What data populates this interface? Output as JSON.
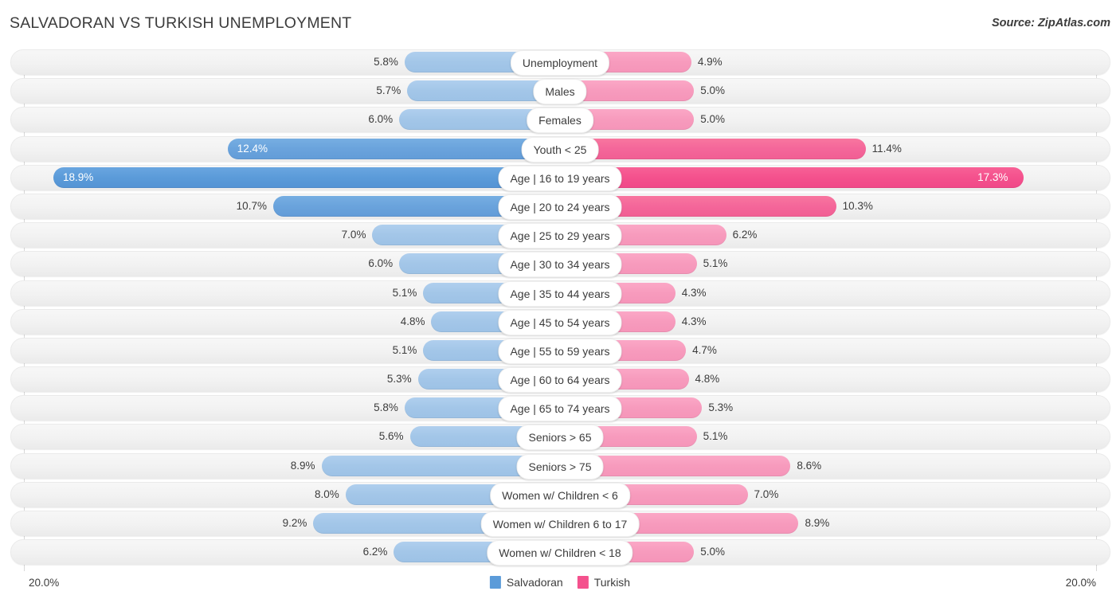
{
  "header": {
    "title": "SALVADORAN VS TURKISH UNEMPLOYMENT",
    "source": "Source: ZipAtlas.com"
  },
  "axis": {
    "min_label": "20.0%",
    "max_label": "20.0%"
  },
  "legend": {
    "items": [
      {
        "label": "Salvadoran",
        "color": "#5b9bd9"
      },
      {
        "label": "Turkish",
        "color": "#f4518d"
      }
    ]
  },
  "colors": {
    "salvadoran_light": "#a3c6e8",
    "salvadoran_mid": "#6aa3dc",
    "salvadoran_dark": "#5b9bd9",
    "turkish_light": "#f79bbd",
    "turkish_mid": "#f4669a",
    "turkish_dark": "#f4518d"
  },
  "chart_data": {
    "type": "bar",
    "title": "SALVADORAN VS TURKISH UNEMPLOYMENT",
    "subtitle": "",
    "xlabel": "",
    "ylabel": "",
    "orientation": "horizontal-diverging",
    "xlim": [
      20.0,
      20.0
    ],
    "grid": true,
    "legend_position": "bottom-center",
    "categories": [
      "Unemployment",
      "Males",
      "Females",
      "Youth < 25",
      "Age | 16 to 19 years",
      "Age | 20 to 24 years",
      "Age | 25 to 29 years",
      "Age | 30 to 34 years",
      "Age | 35 to 44 years",
      "Age | 45 to 54 years",
      "Age | 55 to 59 years",
      "Age | 60 to 64 years",
      "Age | 65 to 74 years",
      "Seniors > 65",
      "Seniors > 75",
      "Women w/ Children < 6",
      "Women w/ Children 6 to 17",
      "Women w/ Children < 18"
    ],
    "series": [
      {
        "name": "Salvadoran",
        "values": [
          5.8,
          5.7,
          6.0,
          12.4,
          18.9,
          10.7,
          7.0,
          6.0,
          5.1,
          4.8,
          5.1,
          5.3,
          5.8,
          5.6,
          8.9,
          8.0,
          9.2,
          6.2
        ],
        "labels": [
          "5.8%",
          "5.7%",
          "6.0%",
          "12.4%",
          "18.9%",
          "10.7%",
          "7.0%",
          "6.0%",
          "5.1%",
          "4.8%",
          "5.1%",
          "5.3%",
          "5.8%",
          "5.6%",
          "8.9%",
          "8.0%",
          "9.2%",
          "6.2%"
        ]
      },
      {
        "name": "Turkish",
        "values": [
          4.9,
          5.0,
          5.0,
          11.4,
          17.3,
          10.3,
          6.2,
          5.1,
          4.3,
          4.3,
          4.7,
          4.8,
          5.3,
          5.1,
          8.6,
          7.0,
          8.9,
          5.0
        ],
        "labels": [
          "4.9%",
          "5.0%",
          "5.0%",
          "11.4%",
          "17.3%",
          "10.3%",
          "6.2%",
          "5.1%",
          "4.3%",
          "4.3%",
          "4.7%",
          "4.8%",
          "5.3%",
          "5.1%",
          "8.6%",
          "7.0%",
          "8.9%",
          "5.0%"
        ]
      }
    ]
  }
}
